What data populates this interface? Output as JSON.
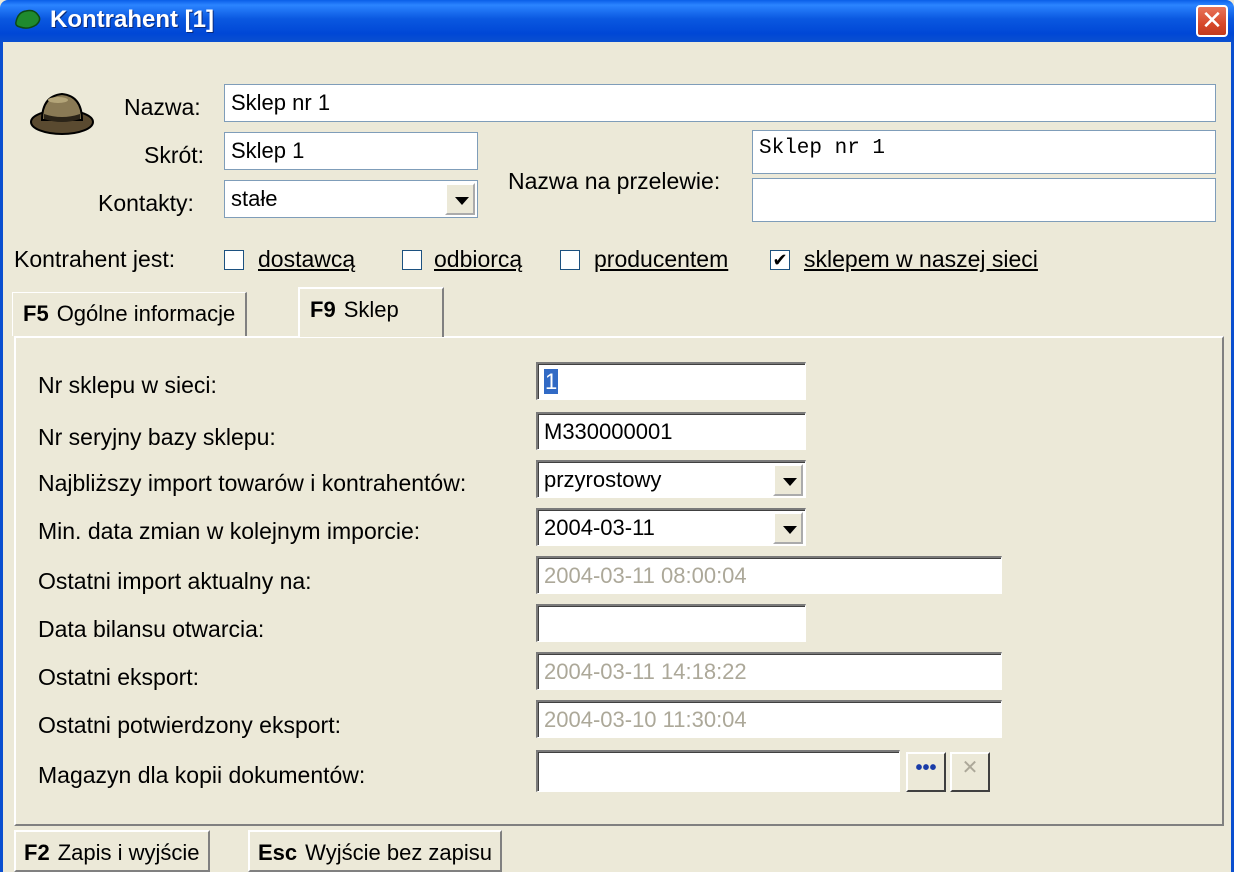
{
  "window": {
    "title": "Kontrahent [1]",
    "close_symbol": "✕",
    "icon": "green-blob-icon"
  },
  "header": {
    "nazwa_label": "Nazwa:",
    "nazwa_value": "Sklep nr 1",
    "skrot_label": "Skrót:",
    "skrot_value": "Sklep 1",
    "kontakty_label": "Kontakty:",
    "kontakty_value": "stałe",
    "przelew_label": "Nazwa na przelewie:",
    "przelew_line1": "Sklep nr 1",
    "przelew_line2": "",
    "avatar_icon": "hat-icon"
  },
  "roles": {
    "label": "Kontrahent jest:",
    "items": [
      {
        "label": "dostawcą",
        "checked": false
      },
      {
        "label": "odbiorcą",
        "checked": false
      },
      {
        "label": "producentem",
        "checked": false
      },
      {
        "label": "sklepem w naszej sieci",
        "checked": true
      }
    ]
  },
  "tabs": [
    {
      "key": "F5",
      "label": "Ogólne informacje",
      "active": false
    },
    {
      "key": "F9",
      "label": "Sklep",
      "active": true
    }
  ],
  "shop": {
    "nr_label": "Nr sklepu w sieci:",
    "nr_value": "1",
    "serial_label": "Nr seryjny bazy sklepu:",
    "serial_value": "M330000001",
    "import_label": "Najbliższy import towarów i kontrahentów:",
    "import_value": "przyrostowy",
    "mindate_label": "Min. data zmian w kolejnym imporcie:",
    "mindate_value": "2004-03-11",
    "lastimport_label": "Ostatni import aktualny na:",
    "lastimport_value": "2004-03-11 08:00:04",
    "bilans_label": "Data bilansu otwarcia:",
    "bilans_value": "",
    "lastexport_label": "Ostatni eksport:",
    "lastexport_value": "2004-03-11 14:18:22",
    "confirmed_label": "Ostatni potwierdzony eksport:",
    "confirmed_value": "2004-03-10 11:30:04",
    "magazyn_label": "Magazyn dla kopii dokumentów:",
    "magazyn_value": "",
    "browse_label": "•••",
    "clear_label": "✕"
  },
  "footer": [
    {
      "key": "F2",
      "label": "Zapis i wyjście"
    },
    {
      "key": "Esc",
      "label": "Wyjście bez zapisu"
    }
  ]
}
